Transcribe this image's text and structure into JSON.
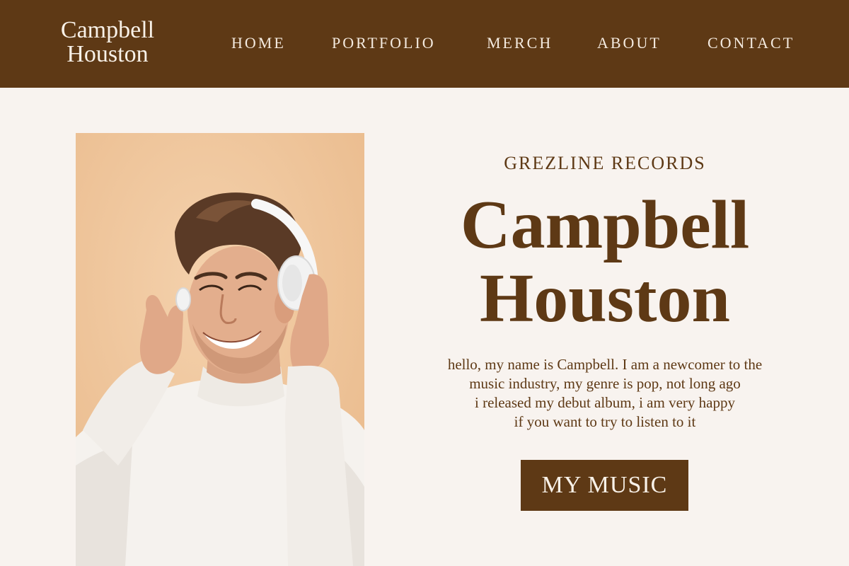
{
  "brand": {
    "line1": "Campbell",
    "line2": "Houston"
  },
  "nav": {
    "items": [
      "HOME",
      "PORTFOLIO",
      "MERCH",
      "ABOUT",
      "CONTACT"
    ]
  },
  "hero": {
    "label": "GREZLINE RECORDS",
    "name_line1": "Campbell",
    "name_line2": "Houston",
    "bio": [
      "hello, my name is Campbell. I am a newcomer to the",
      "music industry, my genre is pop, not long ago",
      "i released my debut album, i am very happy",
      "if you want to try to listen to it"
    ],
    "cta_label": "MY MUSIC"
  },
  "colors": {
    "accent": "#5e3915",
    "background": "#f8f3ef",
    "photo_background": "#efc59b"
  }
}
